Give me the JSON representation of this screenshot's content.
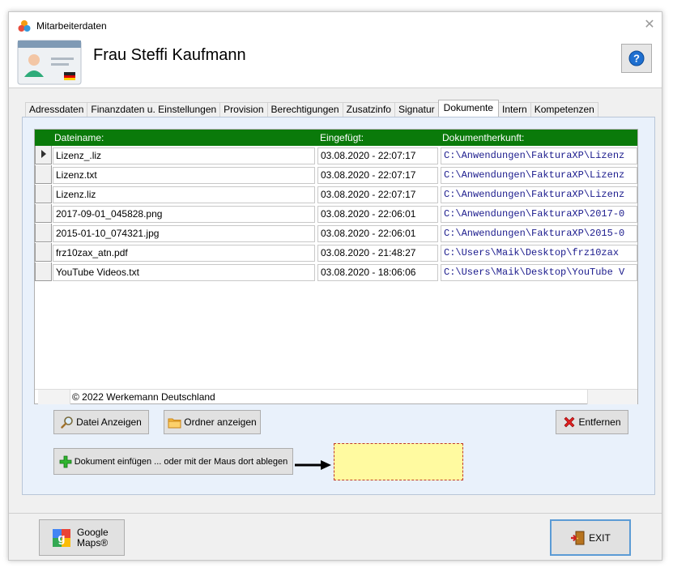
{
  "window": {
    "title": "Mitarbeiterdaten",
    "close_glyph": "✕"
  },
  "header": {
    "employee_name": "Frau Steffi Kaufmann",
    "help_glyph": "?"
  },
  "tabs": [
    {
      "label": "Adressdaten"
    },
    {
      "label": "Finanzdaten u. Einstellungen"
    },
    {
      "label": "Provision"
    },
    {
      "label": "Berechtigungen"
    },
    {
      "label": "Zusatzinfo"
    },
    {
      "label": "Signatur"
    },
    {
      "label": "Dokumente",
      "active": true
    },
    {
      "label": "Intern"
    },
    {
      "label": "Kompetenzen"
    }
  ],
  "grid": {
    "columns": [
      "Dateiname:",
      "Eingefügt:",
      "Dokumentherkunft:"
    ],
    "rows": [
      {
        "name": "Lizenz_.liz",
        "date": "03.08.2020 - 22:07:17",
        "path": "C:\\Anwendungen\\FakturaXP\\Lizenz"
      },
      {
        "name": "Lizenz.txt",
        "date": "03.08.2020 - 22:07:17",
        "path": "C:\\Anwendungen\\FakturaXP\\Lizenz"
      },
      {
        "name": "Lizenz.liz",
        "date": "03.08.2020 - 22:07:17",
        "path": "C:\\Anwendungen\\FakturaXP\\Lizenz"
      },
      {
        "name": "2017-09-01_045828.png",
        "date": "03.08.2020 - 22:06:01",
        "path": "C:\\Anwendungen\\FakturaXP\\2017-0"
      },
      {
        "name": "2015-01-10_074321.jpg",
        "date": "03.08.2020 - 22:06:01",
        "path": "C:\\Anwendungen\\FakturaXP\\2015-0"
      },
      {
        "name": "frz10zax_atn.pdf",
        "date": "03.08.2020 - 21:48:27",
        "path": "C:\\Users\\Maik\\Desktop\\frz10zax"
      },
      {
        "name": "YouTube Videos.txt",
        "date": "03.08.2020 - 18:06:06",
        "path": "C:\\Users\\Maik\\Desktop\\YouTube V"
      }
    ],
    "footer": "© 2022 Werkemann Deutschland"
  },
  "buttons": {
    "open_file": "Datei Anzeigen",
    "open_folder": "Ordner anzeigen",
    "remove": "Entfernen",
    "add_document": "Dokument einfügen ... oder mit der Maus dort ablegen",
    "google_maps_line1": "Google",
    "google_maps_line2": "Maps®",
    "exit": "EXIT"
  },
  "colors": {
    "grid_header": "#0a7a0a",
    "panel_bg": "#e9f1fb",
    "drop_zone": "#fffaa0",
    "drop_zone_border": "#c0392b",
    "path_text": "#1a1a8c"
  },
  "icons": {
    "app": "app-logo-icon",
    "id_card": "id-card-icon",
    "help": "help-icon",
    "magnifier": "magnifier-icon",
    "folder": "folder-icon",
    "remove": "red-x-icon",
    "add": "green-plus-icon",
    "google": "google-icon",
    "exit": "exit-door-icon"
  }
}
